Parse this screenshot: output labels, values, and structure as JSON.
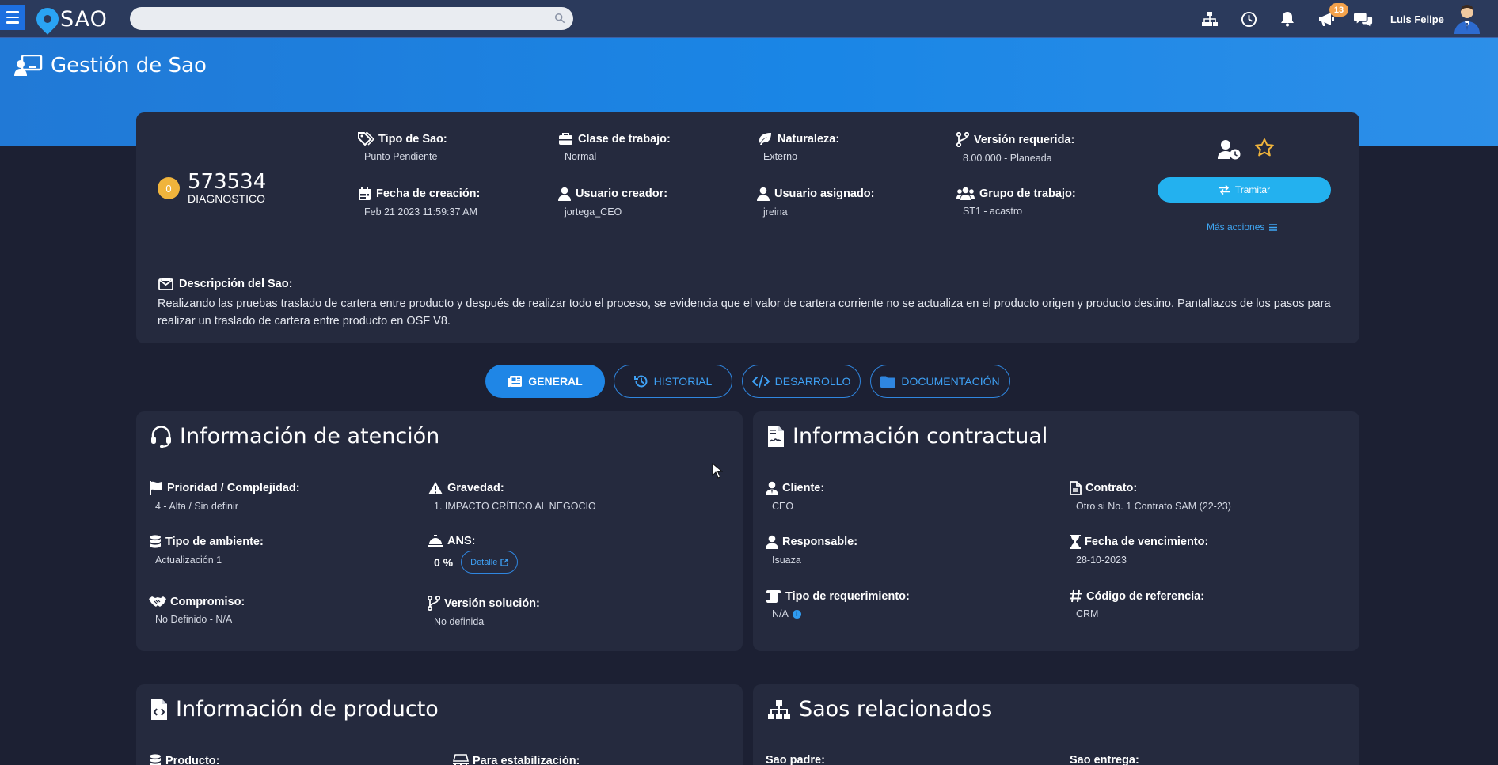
{
  "app": {
    "logo_text": "SAO",
    "search": {
      "placeholder": "",
      "value": ""
    },
    "notifications_count": "13",
    "user_name": "Luis Felipe",
    "page_title": "Gestión de Sao"
  },
  "colors": {
    "topbar": "#2b3a5c",
    "hero": "#1a86e6",
    "page_bg": "#1c2033",
    "card_bg": "#252a3e",
    "accent": "#23b1ef",
    "status_dot": "#f0b43c"
  },
  "icons": [
    "menu-icon",
    "search-icon",
    "sitemap-icon",
    "clock-icon",
    "bell-icon",
    "megaphone-icon",
    "chat-icon",
    "user-clock-icon",
    "star-icon",
    "exchange-icon",
    "bars-icon",
    "tags-icon",
    "briefcase-icon",
    "leaf-icon",
    "code-branch-icon",
    "calendar-icon",
    "user-icon",
    "users-icon",
    "envelope-icon",
    "newspaper-icon",
    "history-icon",
    "code-icon",
    "folder-icon",
    "headset-icon",
    "file-contract-icon",
    "flag-icon",
    "warning-icon",
    "database-icon",
    "bell-concierge-icon",
    "handshake-icon",
    "hourglass-icon",
    "scroll-icon",
    "hashtag-icon",
    "file-code-icon",
    "pallet-icon",
    "external-link-icon",
    "info-icon"
  ],
  "sao": {
    "status_count": "0",
    "id": "573534",
    "state": "DIAGNOSTICO",
    "fields": {
      "tipo_de_sao": {
        "label": "Tipo de Sao:",
        "value": "Punto Pendiente"
      },
      "clase_de_trabajo": {
        "label": "Clase de trabajo:",
        "value": "Normal"
      },
      "naturaleza": {
        "label": "Naturaleza:",
        "value": "Externo"
      },
      "version_requerida": {
        "label": "Versión requerida:",
        "value": "8.00.000 - Planeada"
      },
      "fecha_de_creacion": {
        "label": "Fecha de creación:",
        "value": "Feb 21 2023 11:59:37 AM"
      },
      "usuario_creador": {
        "label": "Usuario creador:",
        "value": "jortega_CEO"
      },
      "usuario_asignado": {
        "label": "Usuario asignado:",
        "value": "jreina"
      },
      "grupo_de_trabajo": {
        "label": "Grupo de trabajo:",
        "value": "ST1 - acastro"
      }
    },
    "actions": {
      "tramitar": "Tramitar",
      "mas_acciones": "Más acciones"
    },
    "description": {
      "label": "Descripción del Sao:",
      "text": "Realizando las pruebas traslado de cartera entre producto y después de realizar todo el proceso, se evidencia que el valor de cartera corriente no se actualiza en el producto origen y producto destino. Pantallazos de los pasos para realizar un traslado de cartera entre producto en OSF V8."
    }
  },
  "tabs": [
    {
      "label": "GENERAL",
      "active": true
    },
    {
      "label": "HISTORIAL",
      "active": false
    },
    {
      "label": "DESARROLLO",
      "active": false
    },
    {
      "label": "DOCUMENTACIÓN",
      "active": false
    }
  ],
  "atencion": {
    "title": "Información de atención",
    "prioridad": {
      "label": "Prioridad / Complejidad:",
      "value": "4 - Alta / Sin definir"
    },
    "gravedad": {
      "label": "Gravedad:",
      "value": "1. IMPACTO CRÍTICO AL NEGOCIO"
    },
    "tipo_ambiente": {
      "label": "Tipo de ambiente:",
      "value": "Actualización 1"
    },
    "ans": {
      "label": "ANS:",
      "value": "0 %",
      "progress": 0,
      "detail_button": "Detalle"
    },
    "compromiso": {
      "label": "Compromiso:",
      "value": "No Definido - N/A"
    },
    "version_solucion": {
      "label": "Versión solución:",
      "value": "No definida"
    }
  },
  "contractual": {
    "title": "Información contractual",
    "cliente": {
      "label": "Cliente:",
      "value": "CEO"
    },
    "contrato": {
      "label": "Contrato:",
      "value": "Otro si No. 1 Contrato SAM (22-23)"
    },
    "responsable": {
      "label": "Responsable:",
      "value": "Isuaza"
    },
    "fecha_vencimiento": {
      "label": "Fecha de vencimiento:",
      "value": "28-10-2023"
    },
    "tipo_requerimiento": {
      "label": "Tipo de requerimiento:",
      "value": "N/A"
    },
    "codigo_referencia": {
      "label": "Código de referencia:",
      "value": "CRM"
    }
  },
  "producto": {
    "title": "Información de producto",
    "producto_label": "Producto:",
    "estabilizacion_label": "Para estabilización:"
  },
  "relacionados": {
    "title": "Saos relacionados",
    "padre_label": "Sao padre:",
    "entrega_label": "Sao entrega:"
  }
}
